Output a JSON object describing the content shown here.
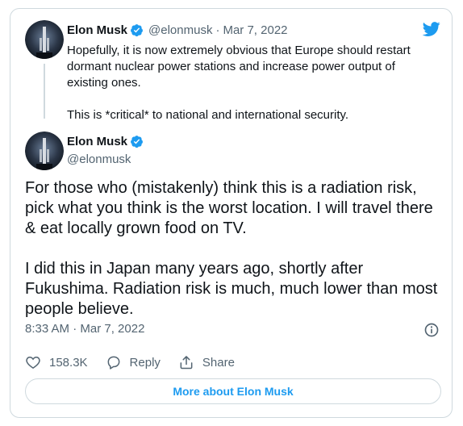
{
  "quoted_tweet": {
    "author_name": "Elon Musk",
    "handle": "@elonmusk",
    "separator": "·",
    "date": "Mar 7, 2022",
    "paragraphs": [
      "Hopefully, it is now extremely obvious that Europe should restart dormant nuclear power stations and increase power output of existing ones.",
      "This is *critical* to national and international security."
    ]
  },
  "main_tweet": {
    "author_name": "Elon Musk",
    "handle": "@elonmusk",
    "paragraphs": [
      "For those who (mistakenly) think this is a radiation risk, pick what you think is the worst location. I will travel there & eat locally grown food on TV.",
      "I did this in Japan many years ago, shortly after Fukushima. Radiation risk is much, much lower than most people believe."
    ],
    "timestamp": "8:33 AM · Mar 7, 2022"
  },
  "actions": {
    "like_count": "158.3K",
    "reply_label": "Reply",
    "share_label": "Share"
  },
  "more_button_label": "More about Elon Musk",
  "colors": {
    "accent": "#1d9bf0",
    "text_primary": "#0f1419",
    "text_secondary": "#536471",
    "border": "#cfd9de"
  },
  "icons": {
    "brand": "twitter-bird-icon",
    "verified": "verified-badge-icon",
    "info": "info-icon",
    "like": "heart-icon",
    "reply": "reply-bubble-icon",
    "share": "share-icon"
  }
}
